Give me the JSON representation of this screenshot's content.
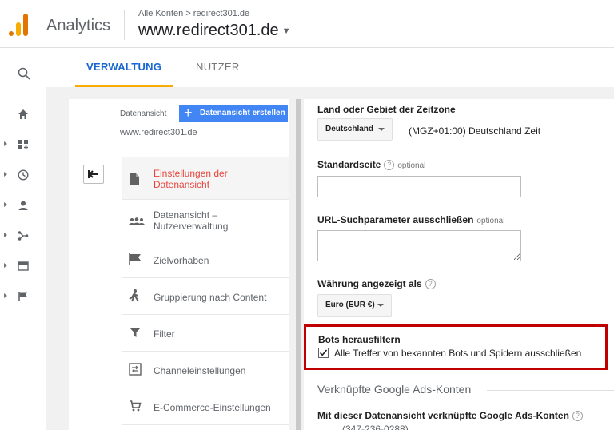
{
  "header": {
    "app_name": "Analytics",
    "breadcrumb": "Alle Konten > redirect301.de",
    "property": "www.redirect301.de"
  },
  "tabs": [
    {
      "label": "VERWALTUNG",
      "active": true
    },
    {
      "label": "NUTZER",
      "active": false
    }
  ],
  "rail_icons": [
    "search-icon",
    "home-icon",
    "customization-icon",
    "realtime-icon",
    "audience-icon",
    "acquisition-icon",
    "behavior-icon",
    "conversions-icon"
  ],
  "view_column": {
    "label": "Datenansicht",
    "create_button": "Datenansicht erstellen",
    "selected_view": "www.redirect301.de",
    "menu": [
      {
        "label": "Einstellungen der Datenansicht",
        "icon": "document-icon",
        "active": true
      },
      {
        "label": "Datenansicht – Nutzerverwaltung",
        "icon": "users-icon",
        "active": false
      },
      {
        "label": "Zielvorhaben",
        "icon": "flag-icon",
        "active": false
      },
      {
        "label": "Gruppierung nach Content",
        "icon": "walker-icon",
        "active": false
      },
      {
        "label": "Filter",
        "icon": "filter-icon",
        "active": false
      },
      {
        "label": "Channeleinstellungen",
        "icon": "channel-icon",
        "active": false
      },
      {
        "label": "E-Commerce-Einstellungen",
        "icon": "cart-icon",
        "active": false
      }
    ]
  },
  "settings": {
    "timezone_label": "Land oder Gebiet der Zeitzone",
    "timezone_country": "Deutschland",
    "timezone_text": "(MGZ+01:00) Deutschland Zeit",
    "default_page_label": "Standardseite",
    "default_page_optional": "optional",
    "default_page_value": "",
    "url_params_label": "URL-Suchparameter ausschließen",
    "url_params_optional": "optional",
    "url_params_value": "",
    "currency_label": "Währung angezeigt als",
    "currency_value": "Euro (EUR €)",
    "bots_title": "Bots herausfiltern",
    "bots_checkbox_label": "Alle Treffer von bekannten Bots und Spidern ausschließen",
    "bots_checked": true,
    "linked_section_title": "Verknüpfte Google Ads-Konten",
    "linked_label": "Mit dieser Datenansicht verknüpfte Google Ads-Konten",
    "linked_value": "(347-236-0288)"
  },
  "colors": {
    "accent_blue": "#1967d2",
    "tab_underline": "#f9ab00",
    "active_menu_text": "#e8453c",
    "highlight_border": "#c00000",
    "create_button_bg": "#4285f4"
  }
}
